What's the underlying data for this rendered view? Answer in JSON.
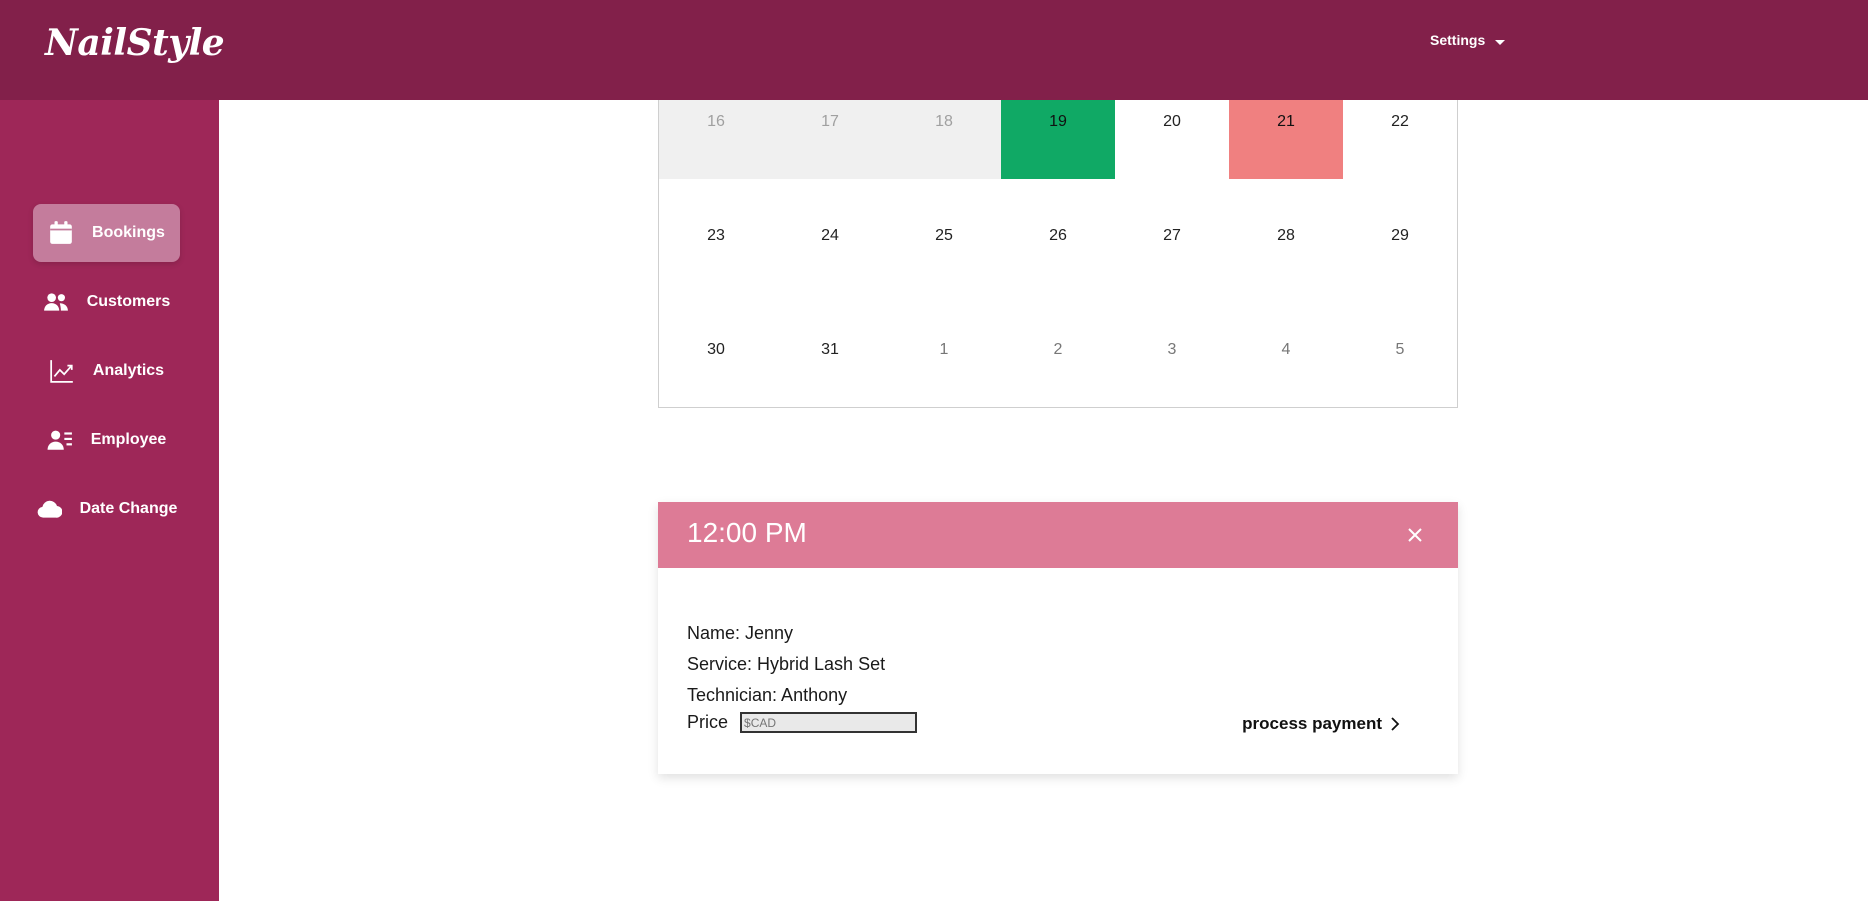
{
  "app": {
    "logo": "NailStyle",
    "settings_label": "Settings"
  },
  "sidebar": {
    "items": [
      {
        "label": "Bookings",
        "icon": "calendar-icon",
        "active": true
      },
      {
        "label": "Customers",
        "icon": "users-icon"
      },
      {
        "label": "Analytics",
        "icon": "chart-line-icon"
      },
      {
        "label": "Employee",
        "icon": "employee-icon"
      },
      {
        "label": "Date Change",
        "icon": "cloud-icon"
      }
    ]
  },
  "calendar": {
    "rows": [
      [
        "16",
        "17",
        "18",
        "19",
        "20",
        "21",
        "22"
      ],
      [
        "23",
        "24",
        "25",
        "26",
        "27",
        "28",
        "29"
      ],
      [
        "30",
        "31",
        "1",
        "2",
        "3",
        "4",
        "5"
      ]
    ],
    "colors": {
      "green": "#10a965",
      "red": "#f08080",
      "past": "#f0f0f0"
    }
  },
  "booking": {
    "time": "12:00 PM",
    "name": "Name: Jenny",
    "service": "Service: Hybrid Lash Set",
    "technician": "Technician: Anthony",
    "price_label": "Price",
    "price_placeholder": "$CAD",
    "pay_label": "process payment"
  },
  "colors": {
    "topbar": "#82204a",
    "sidebar": "#9e2758",
    "header": "#dd7b96"
  }
}
